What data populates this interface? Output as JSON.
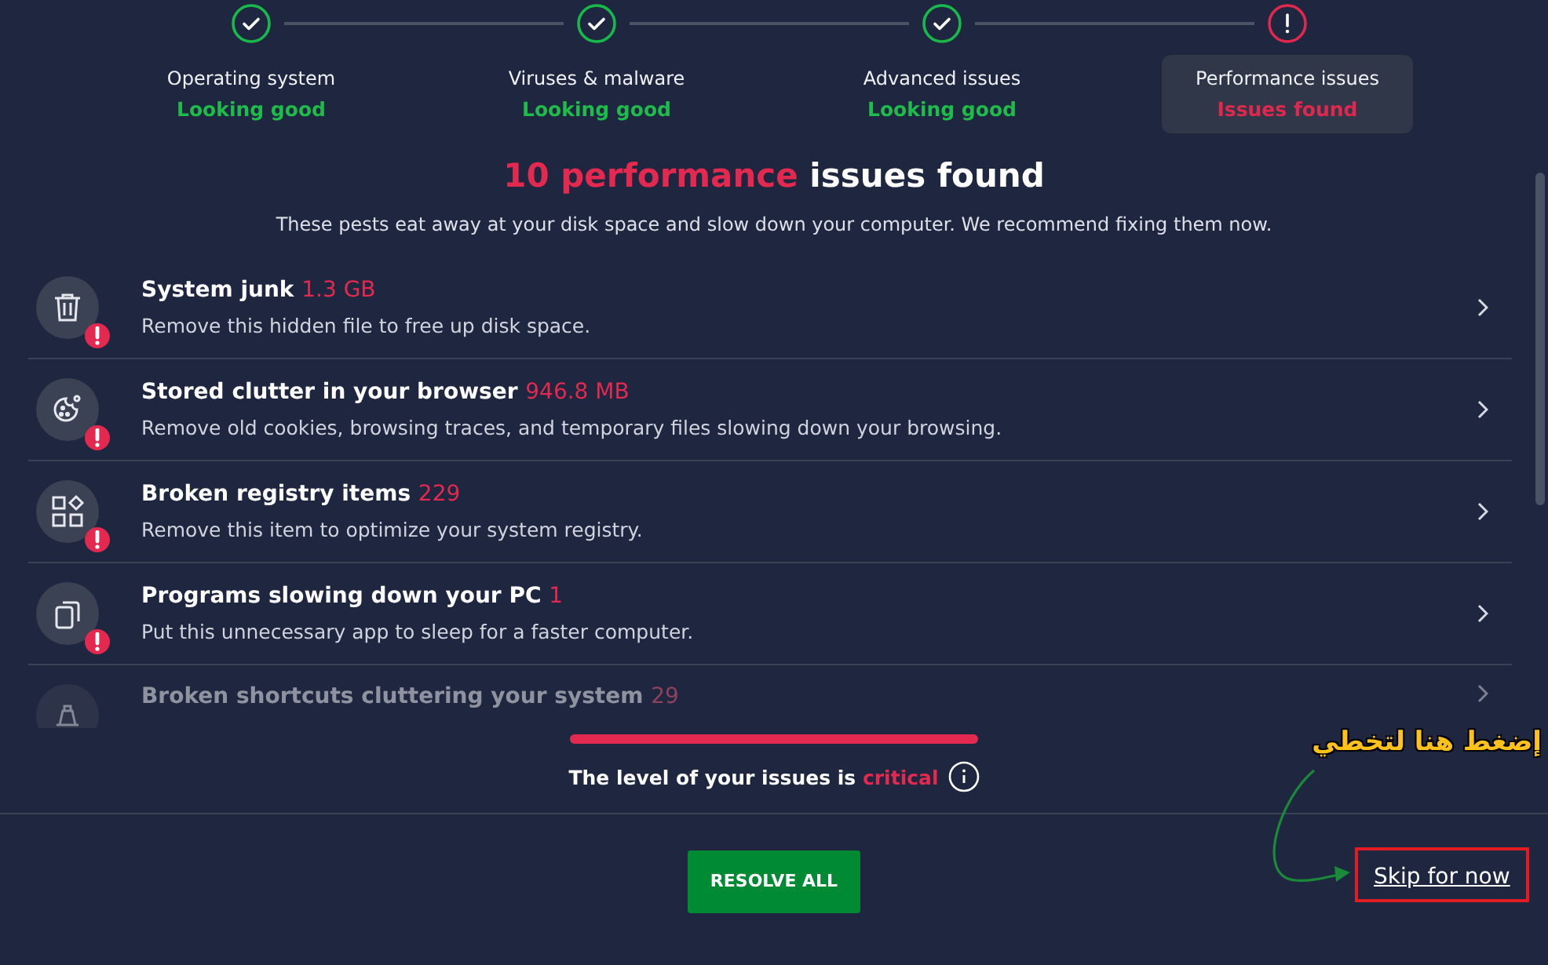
{
  "steps": [
    {
      "label": "Operating system",
      "status": "Looking good",
      "kind": "good",
      "selected": false
    },
    {
      "label": "Viruses & malware",
      "status": "Looking good",
      "kind": "good",
      "selected": false
    },
    {
      "label": "Advanced issues",
      "status": "Looking good",
      "kind": "good",
      "selected": false
    },
    {
      "label": "Performance issues",
      "status": "Issues found",
      "kind": "issue",
      "selected": true
    }
  ],
  "heading": {
    "count": "10 performance",
    "rest": "issues found"
  },
  "subtitle": "These pests eat away at your disk space and slow down your computer. We recommend fixing them now.",
  "issues": [
    {
      "kind": "trash",
      "title": "System junk",
      "amount": "1.3 GB",
      "description": "Remove this hidden file to free up disk space.",
      "faded": false
    },
    {
      "kind": "cookie",
      "title": "Stored clutter in your browser",
      "amount": "946.8 MB",
      "description": "Remove old cookies, browsing traces, and temporary files slowing down your browsing.",
      "faded": false
    },
    {
      "kind": "registry",
      "title": "Broken registry items",
      "amount": "229",
      "description": "Remove this item to optimize your system registry.",
      "faded": false
    },
    {
      "kind": "apps",
      "title": "Programs slowing down your PC",
      "amount": "1",
      "description": "Put this unnecessary app to sleep for a faster computer.",
      "faded": false
    },
    {
      "kind": "shortcut",
      "title": "Broken shortcuts cluttering your system",
      "amount": "29",
      "faded": true
    }
  ],
  "severity": {
    "level": 1,
    "text": "The level of your issues is",
    "value": "critical"
  },
  "resolve_button": "RESOLVE ALL",
  "skip_link": "Skip for now",
  "annotation": {
    "text": "إضغط هنا لتخطي"
  }
}
